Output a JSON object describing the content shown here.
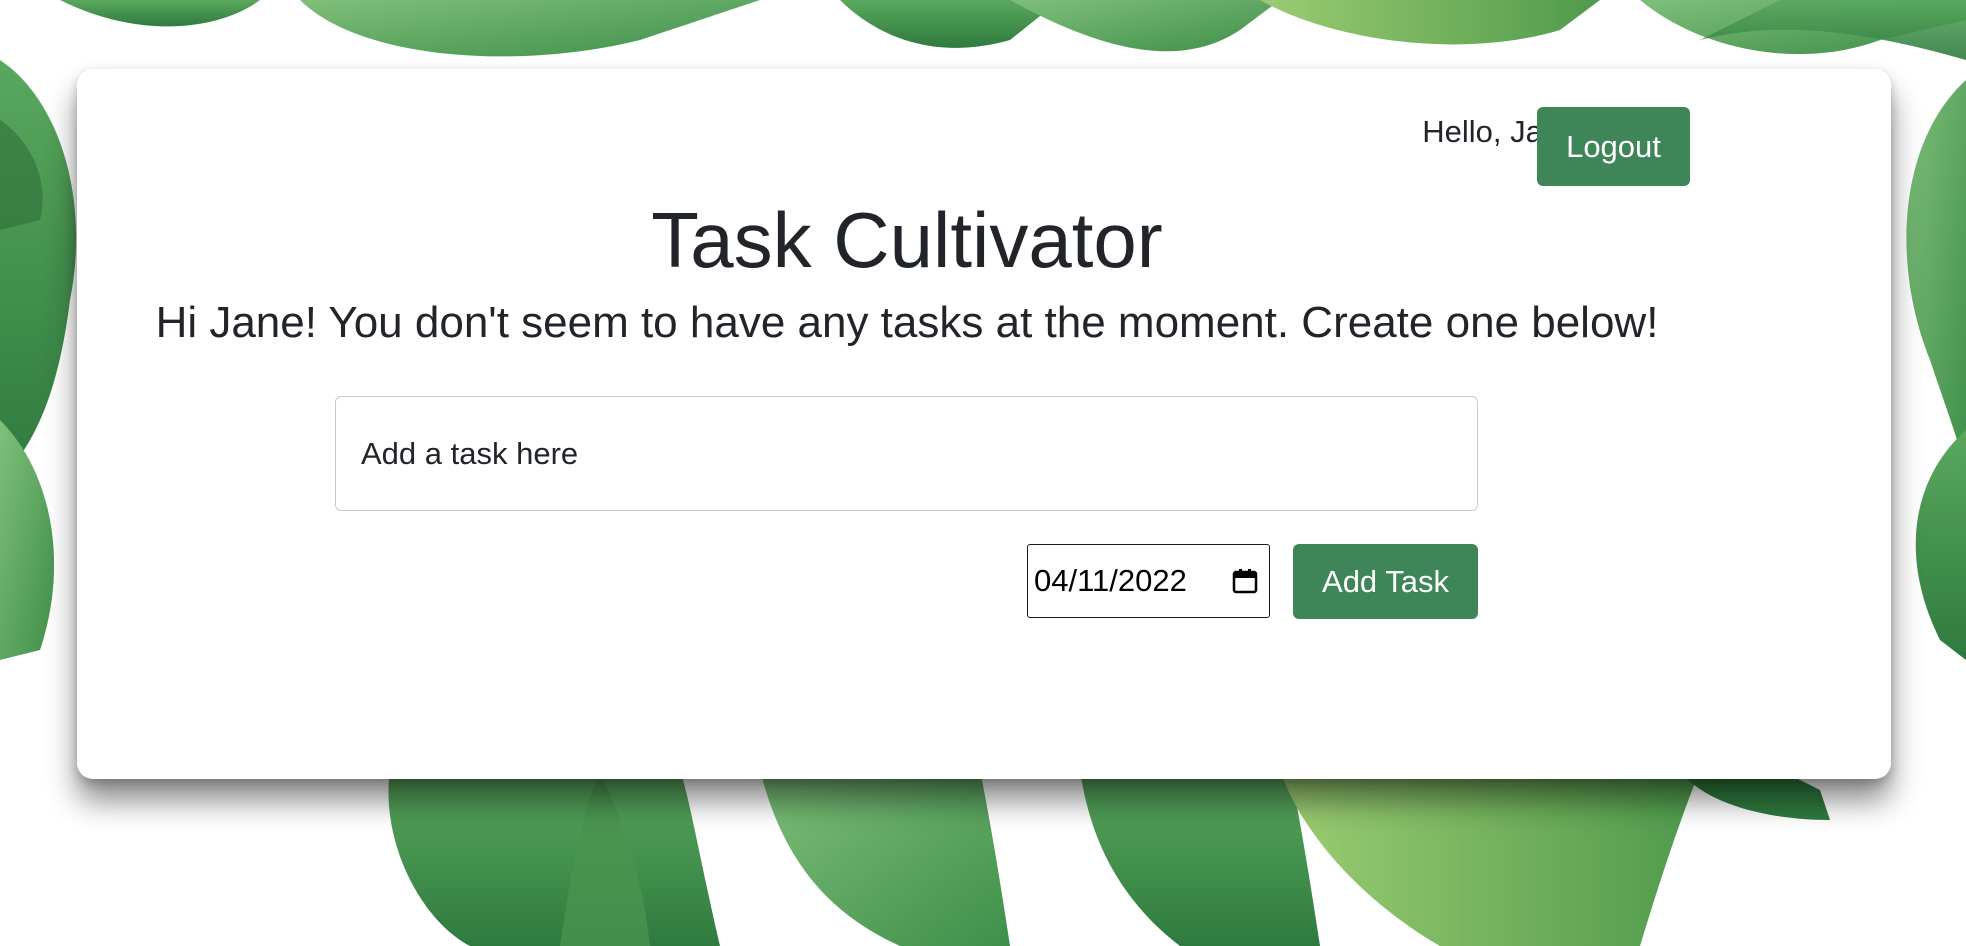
{
  "header": {
    "greeting": "Hello, Jane!",
    "logout_label": "Logout"
  },
  "main": {
    "title": "Task Cultivator",
    "empty_message": "Hi Jane! You don't seem to have any tasks at the moment. Create one below!",
    "task_input": {
      "placeholder": "Add a task here",
      "value": ""
    },
    "date_input": {
      "value": "04/11/2022"
    },
    "add_task_label": "Add Task"
  },
  "icons": {
    "calendar": "calendar-icon",
    "background": "monstera-leaves"
  },
  "colors": {
    "accent": "#3e8558",
    "text": "#212529",
    "card": "#ffffff"
  }
}
